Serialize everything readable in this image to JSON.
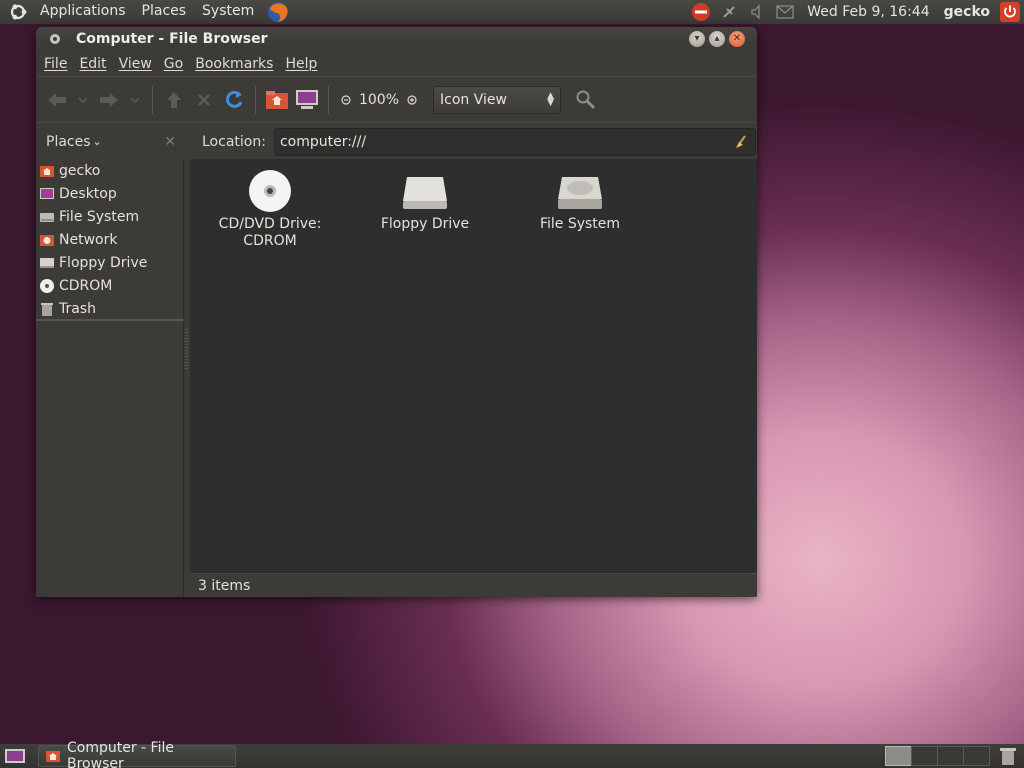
{
  "top_panel": {
    "menus": [
      "Applications",
      "Places",
      "System"
    ],
    "clock": "Wed Feb  9, 16:44",
    "user": "gecko"
  },
  "window": {
    "title": "Computer - File Browser",
    "menubar": [
      "File",
      "Edit",
      "View",
      "Go",
      "Bookmarks",
      "Help"
    ],
    "zoom": "100%",
    "view_mode": "Icon View",
    "places_label": "Places",
    "location_label": "Location:",
    "location_value": "computer:///",
    "sidebar_items": [
      {
        "label": "gecko",
        "icon": "home-folder-icon"
      },
      {
        "label": "Desktop",
        "icon": "desktop-icon"
      },
      {
        "label": "File System",
        "icon": "harddisk-icon"
      },
      {
        "label": "Network",
        "icon": "network-icon"
      },
      {
        "label": "Floppy Drive",
        "icon": "floppy-icon"
      },
      {
        "label": "CDROM",
        "icon": "cdrom-icon"
      },
      {
        "label": "Trash",
        "icon": "trash-icon"
      }
    ],
    "items": [
      {
        "line1": "CD/DVD Drive:",
        "line2": "CDROM",
        "icon": "cdrom-icon"
      },
      {
        "line1": "Floppy Drive",
        "line2": "",
        "icon": "floppy-drive-icon"
      },
      {
        "line1": "File System",
        "line2": "",
        "icon": "harddisk-icon"
      }
    ],
    "status": "3 items"
  },
  "bottom_panel": {
    "task_label": "Computer - File Browser"
  },
  "colors": {
    "panel_bg": "#3c3b37",
    "view_bg": "#2d2f2f",
    "close_button": "#df5b2c"
  }
}
